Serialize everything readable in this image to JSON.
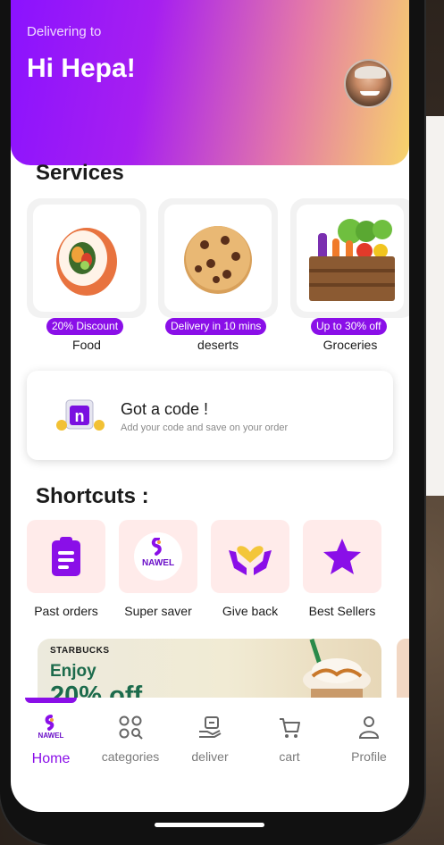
{
  "header": {
    "delivering_label": "Delivering to",
    "greeting": "Hi Hepa!"
  },
  "services": {
    "title": "Services",
    "items": [
      {
        "name": "Food",
        "badge": "20% Discount"
      },
      {
        "name": "deserts",
        "badge": "Delivery in 10 mins"
      },
      {
        "name": "Groceries",
        "badge": "Up to 30% off"
      }
    ]
  },
  "promo_code": {
    "title": "Got a code !",
    "subtitle": "Add your code and save on your order"
  },
  "shortcuts": {
    "title": "Shortcuts :",
    "items": [
      {
        "label": "Past orders"
      },
      {
        "label": "Super saver",
        "logo_text": "NAWEL"
      },
      {
        "label": "Give back"
      },
      {
        "label": "Best Sellers"
      }
    ]
  },
  "banner": {
    "brand": "STARBUCKS",
    "line1": "Enjoy",
    "line2": "20% off"
  },
  "tabs": [
    {
      "label": "Home",
      "active": true,
      "logo_text": "NAWEL"
    },
    {
      "label": "categories",
      "active": false
    },
    {
      "label": "deliver",
      "active": false
    },
    {
      "label": "cart",
      "active": false
    },
    {
      "label": "Profile",
      "active": false
    }
  ],
  "colors": {
    "brand_purple": "#8a0fe8",
    "shortcut_bg": "#ffebea"
  }
}
